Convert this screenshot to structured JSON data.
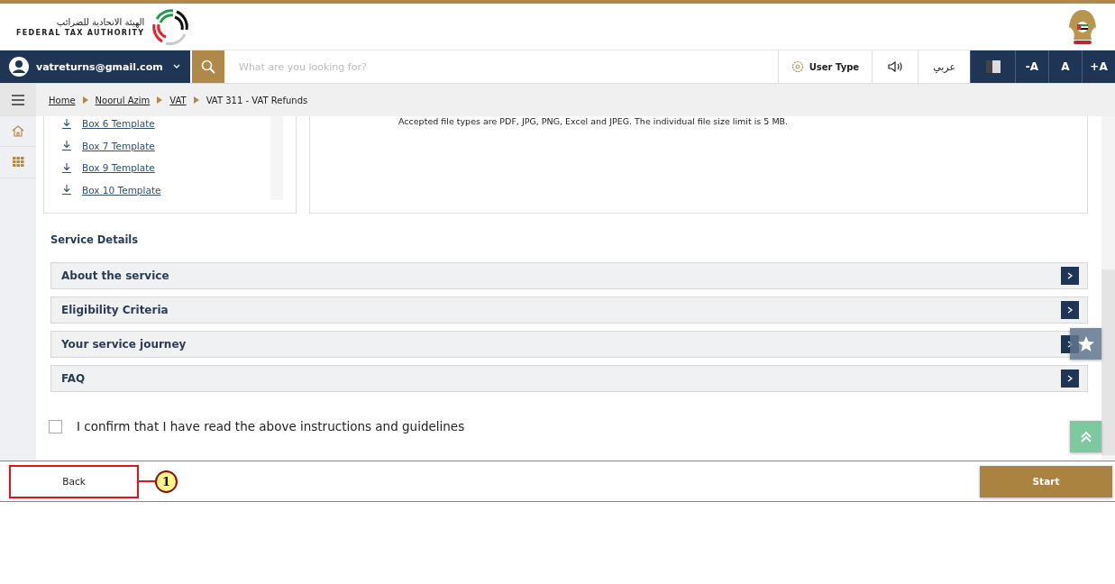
{
  "header": {
    "logo_arabic": "الهيئة الاتحادية للضرائب",
    "logo_english": "FEDERAL TAX AUTHORITY"
  },
  "nav": {
    "account": "vatreturns@gmail.com",
    "search": {
      "placeholder": "What are you looking for?"
    },
    "user_type": "User Type",
    "language": "عربي",
    "font_buttons": [
      "-A",
      "A",
      "+A"
    ]
  },
  "breadcrumb": [
    {
      "label": "Home",
      "link": true
    },
    {
      "label": "Noorul Azim",
      "link": true
    },
    {
      "label": "VAT",
      "link": true
    },
    {
      "label": "VAT 311 - VAT Refunds",
      "link": false
    }
  ],
  "templates": [
    "Box 6 Template",
    "Box 7 Template",
    "Box 9 Template",
    "Box 10 Template"
  ],
  "upload_note": "Accepted file types are PDF, JPG, PNG, Excel and JPEG. The individual file size limit is 5 MB.",
  "service_details": {
    "title": "Service Details",
    "sections": [
      {
        "label": "About the service",
        "expanded": false
      },
      {
        "label": "Eligibility Criteria",
        "expanded": false
      },
      {
        "label": "Your service journey",
        "expanded": false
      },
      {
        "label": "FAQ",
        "expanded": false
      }
    ]
  },
  "confirm": {
    "label": "I confirm that I have read the above instructions and guidelines",
    "checked": false
  },
  "footer": {
    "back": "Back",
    "start": "Start"
  },
  "annotation": {
    "number": "1"
  }
}
